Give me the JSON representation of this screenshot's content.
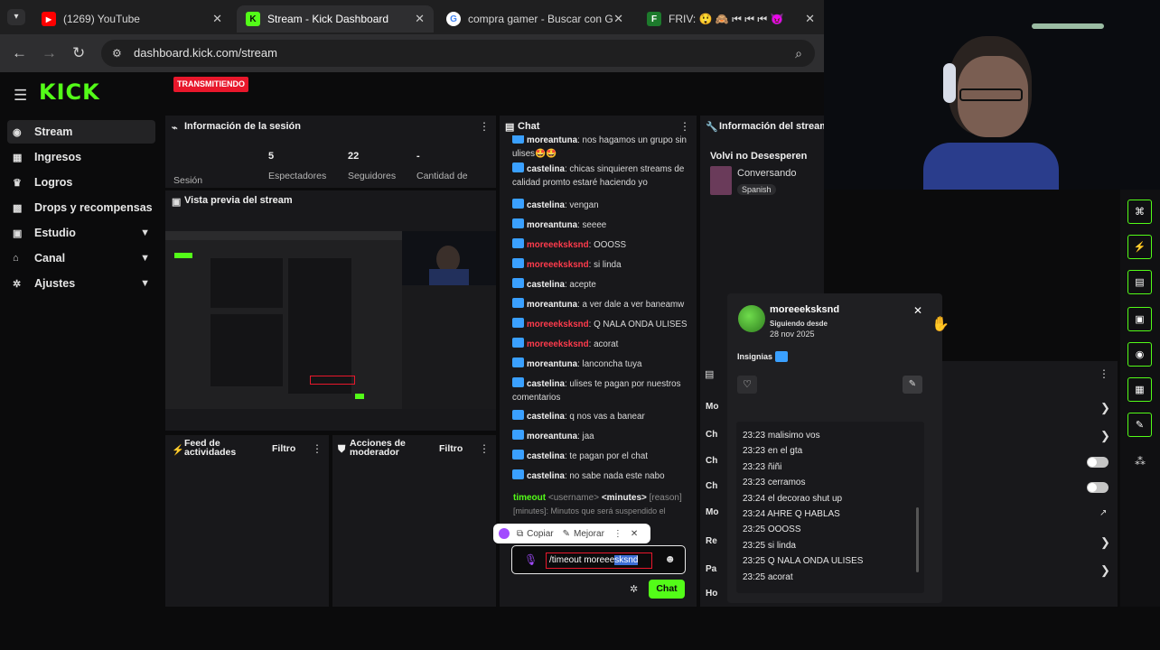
{
  "tabs": [
    {
      "title": "(1269) YouTube",
      "icon": "youtube-icon"
    },
    {
      "title": "Stream - Kick Dashboard",
      "icon": "kick-icon"
    },
    {
      "title": "compra gamer - Buscar con Go",
      "icon": "google-icon"
    },
    {
      "title": "FRIV: 😲 🙈 ⏮ ⏮ ⏮ 😈",
      "icon": "friv-icon"
    }
  ],
  "address": {
    "url": "dashboard.kick.com/stream"
  },
  "brand": {
    "logo": "KICK",
    "accent": "#53fc18"
  },
  "sidebar": [
    {
      "label": "Stream",
      "icon": "stream-icon",
      "active": true
    },
    {
      "label": "Ingresos",
      "icon": "revenue-icon"
    },
    {
      "label": "Logros",
      "icon": "trophy-icon"
    },
    {
      "label": "Drops y recompensas",
      "icon": "gift-icon"
    },
    {
      "label": "Estudio",
      "icon": "studio-icon",
      "expandable": true
    },
    {
      "label": "Canal",
      "icon": "channel-icon",
      "expandable": true
    },
    {
      "label": "Ajustes",
      "icon": "gear-icon",
      "expandable": true
    }
  ],
  "session": {
    "title": "Información de la sesión",
    "status": "TRANSMITIENDO",
    "session_label": "Sesión",
    "stats": [
      {
        "value": "5",
        "label": "Espectadores"
      },
      {
        "value": "22",
        "label": "Seguidores"
      },
      {
        "value": "-",
        "label": "Cantidad de"
      }
    ]
  },
  "preview": {
    "title": "Vista previa del stream"
  },
  "activity": {
    "title": "Feed de actividades",
    "filter": "Filtro"
  },
  "modactions": {
    "title": "Acciones de moderador",
    "filter": "Filtro"
  },
  "chat": {
    "title": "Chat",
    "messages": [
      {
        "user": "moreantuna",
        "text": "nos hagamos un grupo sin ulises🤩🤩",
        "red": false
      },
      {
        "user": "castelina",
        "text": "chicas sinquieren streams de calidad promto estaré haciendo yo",
        "red": false
      },
      {
        "user": "castelina",
        "text": "vengan",
        "red": false
      },
      {
        "user": "moreantuna",
        "text": "seeee",
        "red": false
      },
      {
        "user": "moreeeksksnd",
        "text": "OOOSS",
        "red": true
      },
      {
        "user": "moreeeksksnd",
        "text": "si linda",
        "red": true
      },
      {
        "user": "castelina",
        "text": "acepte",
        "red": false
      },
      {
        "user": "moreantuna",
        "text": "a ver dale a ver baneamw",
        "red": false
      },
      {
        "user": "moreeeksksnd",
        "text": "Q NALA ONDA ULISES",
        "red": true
      },
      {
        "user": "moreeeksksnd",
        "text": "acorat",
        "red": true
      },
      {
        "user": "moreantuna",
        "text": "lanconcha tuya",
        "red": false
      },
      {
        "user": "castelina",
        "text": "ulises te pagan por nuestros comentarios",
        "red": false
      },
      {
        "user": "castelina",
        "text": "q nos vas a banear",
        "red": false
      },
      {
        "user": "moreantuna",
        "text": "jaa",
        "red": false
      },
      {
        "user": "castelina",
        "text": "te pagan por el chat",
        "red": false
      },
      {
        "user": "castelina",
        "text": "no sabe nada este nabo",
        "red": false
      }
    ],
    "command_hint": {
      "cmd": "timeout",
      "arg1": "<username>",
      "arg2": "<minutes>",
      "arg3": "[reason]",
      "desc": "[minutes]: Minutos que será suspendido el"
    },
    "ai_copy": "Copiar",
    "ai_improve": "Mejorar",
    "input_value": "/timeout moreeeksksnd",
    "input_selected": "sksnd",
    "send_label": "Chat"
  },
  "stream_info": {
    "title": "Información del stream",
    "stream_title": "Volvi no Desesperen",
    "category": "Conversando",
    "language": "Spanish"
  },
  "popup": {
    "username": "moreeeksksnd",
    "following_label": "Siguiendo desde",
    "following_date": "28 nov 2025",
    "badges_label": "Insignias",
    "messages": [
      {
        "time": "23:23",
        "text": "malisimo vos"
      },
      {
        "time": "23:23",
        "text": "en el gta"
      },
      {
        "time": "23:23",
        "text": "ñiñi"
      },
      {
        "time": "23:23",
        "text": "cerramos"
      },
      {
        "time": "23:24",
        "text": "el decorao shut up"
      },
      {
        "time": "23:24",
        "text": "AHRE Q HABLAS"
      },
      {
        "time": "23:25",
        "text": "OOOSS"
      },
      {
        "time": "23:25",
        "text": "si linda"
      },
      {
        "time": "23:25",
        "text": "Q NALA ONDA ULISES"
      },
      {
        "time": "23:25",
        "text": "acorat"
      }
    ]
  },
  "modpanel": {
    "rows": [
      "Mo",
      "Ch",
      "Ch",
      "Ch",
      "Mo",
      "Re",
      "Pa",
      "Ho"
    ]
  }
}
